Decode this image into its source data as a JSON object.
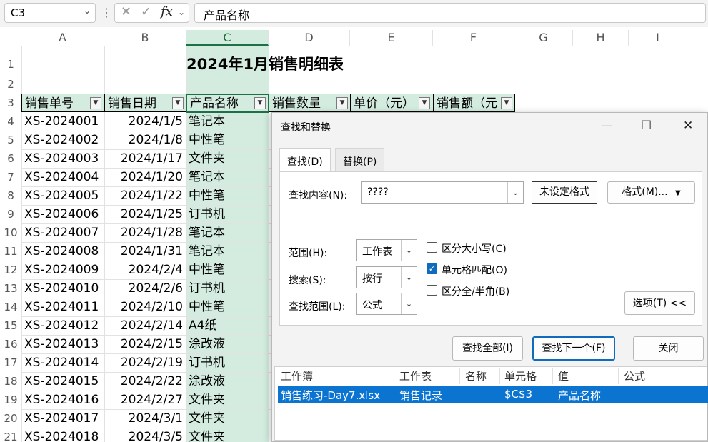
{
  "formula_bar": {
    "name_box": "C3",
    "cancel_icon": "✕",
    "enter_icon": "✓",
    "fx_label": "fx",
    "content": "产品名称"
  },
  "columns": [
    "A",
    "B",
    "C",
    "D",
    "E",
    "F",
    "G",
    "H",
    "I"
  ],
  "rows": [
    "1",
    "2",
    "3",
    "4",
    "5",
    "6",
    "7",
    "8",
    "9",
    "10",
    "11",
    "12",
    "13",
    "14",
    "15",
    "16",
    "17",
    "18",
    "19",
    "20",
    "21"
  ],
  "sheet": {
    "title": "2024年1月销售明细表",
    "headers": [
      "销售单号",
      "销售日期",
      "产品名称",
      "销售数量",
      "单价（元）",
      "销售额（元"
    ],
    "data": [
      [
        "XS-2024001",
        "2024/1/5",
        "笔记本"
      ],
      [
        "XS-2024002",
        "2024/1/8",
        "中性笔"
      ],
      [
        "XS-2024003",
        "2024/1/17",
        "文件夹"
      ],
      [
        "XS-2024004",
        "2024/1/20",
        "笔记本"
      ],
      [
        "XS-2024005",
        "2024/1/22",
        "中性笔"
      ],
      [
        "XS-2024006",
        "2024/1/25",
        "订书机"
      ],
      [
        "XS-2024007",
        "2024/1/28",
        "笔记本"
      ],
      [
        "XS-2024008",
        "2024/1/31",
        "笔记本"
      ],
      [
        "XS-2024009",
        "2024/2/4",
        "中性笔"
      ],
      [
        "XS-2024010",
        "2024/2/6",
        "订书机"
      ],
      [
        "XS-2024011",
        "2024/2/10",
        "中性笔"
      ],
      [
        "XS-2024012",
        "2024/2/14",
        "A4纸"
      ],
      [
        "XS-2024013",
        "2024/2/15",
        "涂改液"
      ],
      [
        "XS-2024014",
        "2024/2/19",
        "订书机"
      ],
      [
        "XS-2024015",
        "2024/2/22",
        "涂改液"
      ],
      [
        "XS-2024016",
        "2024/2/27",
        "文件夹"
      ],
      [
        "XS-2024017",
        "2024/3/1",
        "文件夹"
      ],
      [
        "XS-2024018",
        "2024/3/5",
        "文件夹"
      ]
    ]
  },
  "dialog": {
    "title": "查找和替换",
    "minimize": "—",
    "maximize": "☐",
    "close": "✕",
    "tab_find": "查找(D)",
    "tab_replace": "替换(P)",
    "find_label": "查找内容(N):",
    "find_value": "????",
    "format_status": "未设定格式",
    "format_button": "格式(M)...",
    "scope_label": "范围(H):",
    "scope_value": "工作表",
    "search_label": "搜索(S):",
    "search_value": "按行",
    "lookin_label": "查找范围(L):",
    "lookin_value": "公式",
    "match_case": "区分大小写(C)",
    "match_case_checked": false,
    "match_entire": "单元格匹配(O)",
    "match_entire_checked": true,
    "match_width": "区分全/半角(B)",
    "match_width_checked": false,
    "options_button": "选项(T) <<",
    "find_all": "查找全部(I)",
    "find_next": "查找下一个(F)",
    "close_button": "关闭",
    "results_headers": [
      "工作簿",
      "工作表",
      "名称",
      "单元格",
      "值",
      "公式"
    ],
    "results_rows": [
      [
        "销售练习-Day7.xlsx",
        "销售记录",
        "",
        "$C$3",
        "产品名称",
        ""
      ]
    ]
  },
  "colors": {
    "accent": "#1e7145",
    "selection_fill": "#d3ecdf",
    "result_highlight": "#0b74d1"
  }
}
